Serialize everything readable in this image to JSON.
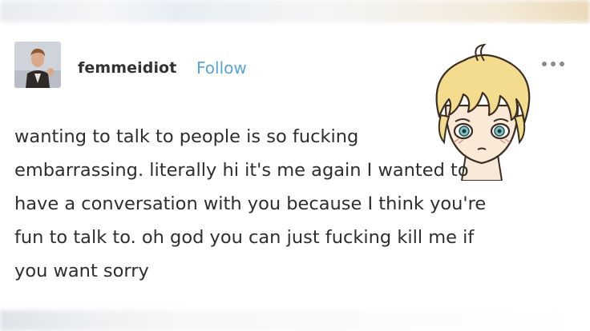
{
  "post": {
    "username": "femmeidiot",
    "follow_label": "Follow",
    "body_lines": [
      "wanting to talk to people is so fucking",
      "embarrassing. literally hi it's me again I wanted to",
      "have a conversation with you because I think you're",
      "fun to talk to. oh god you can just fucking kill me if",
      "you want sorry"
    ]
  },
  "icons": {
    "avatar": "avatar-photo",
    "more": "more-horizontal-icon",
    "sticker": "blonde-anime-character-sticker"
  },
  "colors": {
    "follow_link": "#56a4d8",
    "text": "#2e2e2e",
    "background": "#ffffff"
  }
}
